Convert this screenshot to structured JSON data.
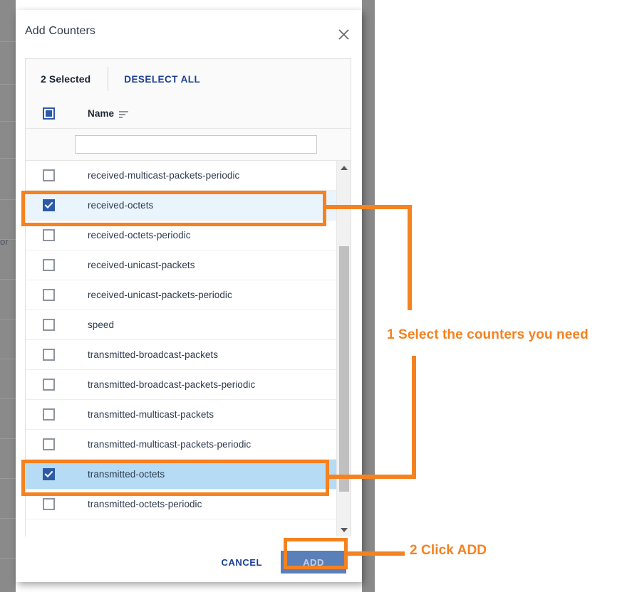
{
  "modal": {
    "title": "Add Counters",
    "close_icon": "close-icon",
    "toolbar": {
      "selected_count_label": "2 Selected",
      "deselect_all_label": "DESELECT ALL"
    },
    "column_header": {
      "name_label": "Name",
      "sort_icon": "sort-descending-icon",
      "select_all_icon": "indeterminate-checkbox-icon"
    },
    "filter": {
      "value": "",
      "placeholder": ""
    },
    "list": [
      {
        "label": "received-multicast-packets-periodic",
        "checked": false,
        "hovered": false
      },
      {
        "label": "received-octets",
        "checked": true,
        "hovered": false
      },
      {
        "label": "received-octets-periodic",
        "checked": false,
        "hovered": false
      },
      {
        "label": "received-unicast-packets",
        "checked": false,
        "hovered": false
      },
      {
        "label": "received-unicast-packets-periodic",
        "checked": false,
        "hovered": false
      },
      {
        "label": "speed",
        "checked": false,
        "hovered": false
      },
      {
        "label": "transmitted-broadcast-packets",
        "checked": false,
        "hovered": false
      },
      {
        "label": "transmitted-broadcast-packets-periodic",
        "checked": false,
        "hovered": false
      },
      {
        "label": "transmitted-multicast-packets",
        "checked": false,
        "hovered": false
      },
      {
        "label": "transmitted-multicast-packets-periodic",
        "checked": false,
        "hovered": false
      },
      {
        "label": "transmitted-octets",
        "checked": true,
        "hovered": true
      },
      {
        "label": "transmitted-octets-periodic",
        "checked": false,
        "hovered": false
      }
    ],
    "scrollbar": {
      "up_arrow_icon": "triangle-up-icon",
      "down_arrow_icon": "triangle-down-icon"
    },
    "footer": {
      "cancel_label": "CANCEL",
      "add_label": "ADD"
    }
  },
  "background": {
    "text_fragment": "or"
  },
  "annotations": {
    "accent_color": "#f58220",
    "step1_text": "1 Select the counters you need",
    "step2_text": "2 Click ADD"
  },
  "colors": {
    "accent_orange": "#f58220",
    "selected_row": "#eaf4fd",
    "hovered_selected_row": "#b6dbf4",
    "checkbox_blue": "#2c5aa8",
    "link_blue": "#1c3f94",
    "add_button": "#5b7fb9",
    "backdrop_grey": "#8a8a8a"
  }
}
